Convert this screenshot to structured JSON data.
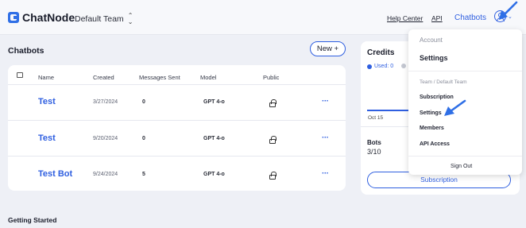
{
  "header": {
    "brand": "ChatNode",
    "team": "Default Team",
    "links": [
      "Help Center",
      "API"
    ],
    "active_link": "Chatbots"
  },
  "chatbots": {
    "title": "Chatbots",
    "new_button": "New +",
    "columns": [
      "Name",
      "Created",
      "Messages Sent",
      "Model",
      "Public"
    ],
    "rows": [
      {
        "name": "Test",
        "created": "3/27/2024",
        "messages": "0",
        "model": "GPT 4-o"
      },
      {
        "name": "Test",
        "created": "9/20/2024",
        "messages": "0",
        "model": "GPT 4-o"
      },
      {
        "name": "Test Bot",
        "created": "9/24/2024",
        "messages": "5",
        "model": "GPT 4-o"
      }
    ],
    "more": "···"
  },
  "credits": {
    "title": "Credits",
    "used_label": "Used: 0",
    "date": "Oct 15",
    "bots_title": "Bots",
    "bots_value": "3/10",
    "subscription_button": "Subscription"
  },
  "dropdown": {
    "account_header": "Account",
    "account_settings": "Settings",
    "team_header": "Team / Default Team",
    "items": [
      "Subscription",
      "Settings",
      "Members",
      "API Access"
    ],
    "sign_out": "Sign Out"
  },
  "footer": {
    "getting_started": "Getting Started"
  },
  "colors": {
    "accent": "#2f5fe0",
    "background": "#eef0f6"
  }
}
